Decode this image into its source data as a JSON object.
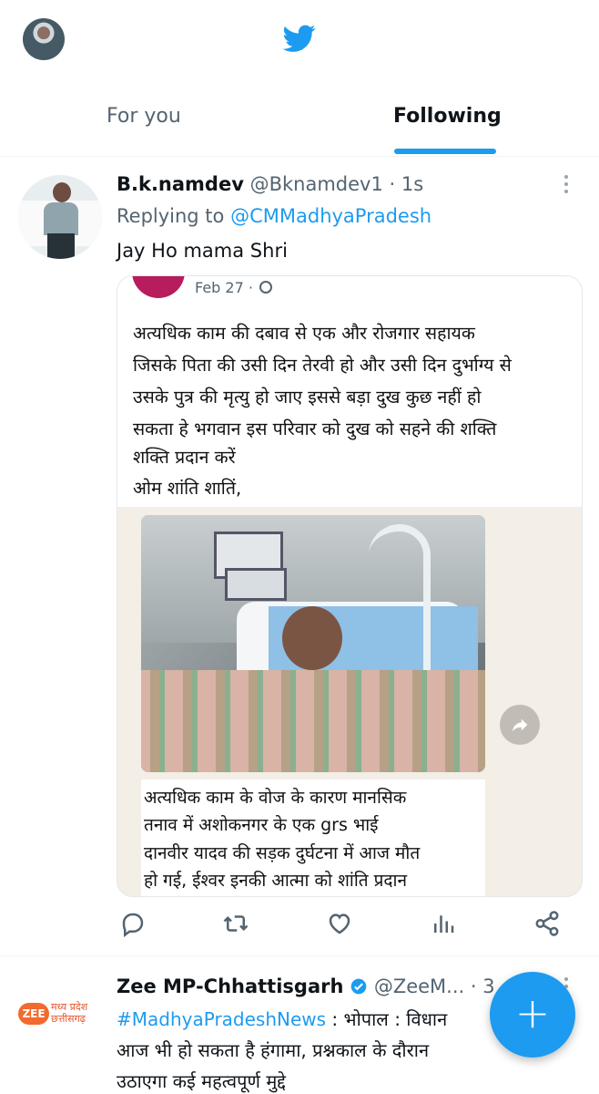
{
  "header": {
    "logo_icon": "twitter-bird-icon",
    "brand_color": "#1d9bf0"
  },
  "tabs": [
    {
      "label": "For you",
      "active": false
    },
    {
      "label": "Following",
      "active": true
    }
  ],
  "tweet1": {
    "name": "B.k.namdev",
    "handle": "@Bknamdev1",
    "separator": "·",
    "time": "1s",
    "replying_prefix": "Replying to",
    "replying_to": "@CMMadhyaPradesh",
    "text": "Jay Ho mama Shri",
    "media": {
      "date": "Feb 27 ·",
      "top_lines": [
        "अत्यधिक काम की दबाव से एक और रोजगार सहायक",
        "जिसके पिता की उसी दिन तेरवी हो और उसी दिन दुर्भाग्य से",
        "उसके पुत्र की मृत्यु हो जाए इससे बड़ा दुख  कुछ नहीं हो",
        "सकता हे भगवान इस परिवार को दुख को सहने की शक्ति",
        "शक्ति प्रदान करें",
        "ओम शांति शातिं,"
      ],
      "bottom_lines": [
        "अत्यधिक काम के वोज के कारण  मानसिक",
        "तनाव में अशोकनगर के  एक grs भाई",
        "दानवीर यादव की सड़क दुर्घटना में आज मौत",
        "हो गई, ईश्वर इनकी आत्मा को शांति प्रदान"
      ]
    },
    "actions": [
      "reply-icon",
      "retweet-icon",
      "like-icon",
      "analytics-icon",
      "share-icon"
    ]
  },
  "tweet2": {
    "name": "Zee MP-Chhattisgarh",
    "handle": "@ZeeM...",
    "separator": "·",
    "time": "3",
    "logo_badge": "ZEE",
    "logo_line1": "मध्य प्रदेश",
    "logo_line2": "छत्तीसगढ़",
    "hashtag": "#MadhyaPradeshNews",
    "line1_rest": " : भोपाल : विधान",
    "line2": "आज भी हो सकता है हंगामा, प्रश्नकाल के दौरान",
    "line3": "उठाएगा कई महत्वपूर्ण मुद्दे"
  },
  "fab": {
    "label": "+"
  }
}
